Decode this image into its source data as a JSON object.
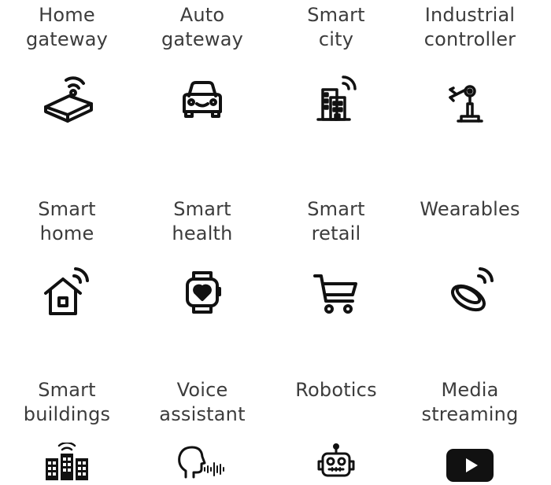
{
  "tiles": [
    {
      "label": "Home\ngateway",
      "icon": "home-gateway-icon"
    },
    {
      "label": "Auto\ngateway",
      "icon": "car-icon"
    },
    {
      "label": "Smart\ncity",
      "icon": "city-building-icon"
    },
    {
      "label": "Industrial\ncontroller",
      "icon": "robotic-arm-icon"
    },
    {
      "label": "Smart\nhome",
      "icon": "smart-home-icon"
    },
    {
      "label": "Smart\nhealth",
      "icon": "smartwatch-heart-icon"
    },
    {
      "label": "Smart\nretail",
      "icon": "shopping-cart-icon"
    },
    {
      "label": "Wearables",
      "icon": "smart-ring-icon"
    },
    {
      "label": "Smart\nbuildings",
      "icon": "connected-buildings-icon"
    },
    {
      "label": "Voice\nassistant",
      "icon": "voice-assistant-icon"
    },
    {
      "label": "Robotics",
      "icon": "robot-icon"
    },
    {
      "label": "Media\nstreaming",
      "icon": "play-button-icon"
    }
  ]
}
